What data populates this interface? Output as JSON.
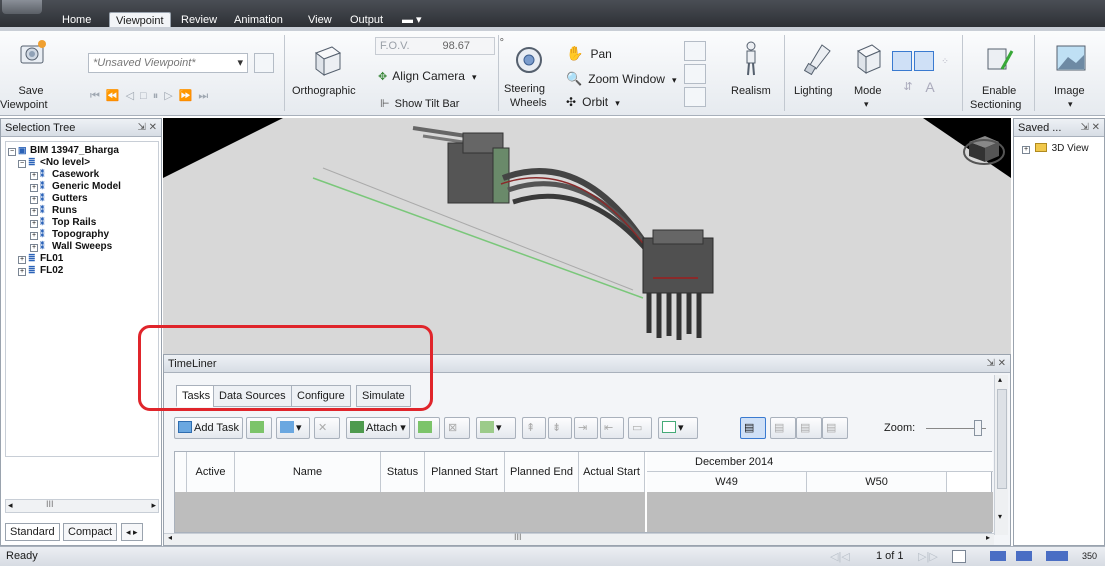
{
  "menu": {
    "tabs": [
      "Home",
      "Viewpoint",
      "Review",
      "Animation",
      "View",
      "Output"
    ],
    "active": "Viewpoint"
  },
  "ribbon": {
    "save_viewpoint": "Save\nViewpoint",
    "save_line1": "Save",
    "save_line2": "Viewpoint",
    "viewpoint_combo": "*Unsaved Viewpoint*",
    "orthographic": "Orthographic",
    "fov_label": "F.O.V.",
    "fov_value": "98.67",
    "fov_unit": "°",
    "align_camera": "Align Camera",
    "show_tilt_bar": "Show Tilt Bar",
    "steering_line1": "Steering",
    "steering_line2": "Wheels",
    "pan": "Pan",
    "zoom_window": "Zoom Window",
    "orbit": "Orbit",
    "realism": "Realism",
    "lighting": "Lighting",
    "mode": "Mode",
    "enable_line1": "Enable",
    "enable_line2": "Sectioning",
    "image": "Image"
  },
  "selection_tree": {
    "title": "Selection Tree",
    "items": [
      {
        "label": "BIM 13947_Bharga",
        "depth": 0
      },
      {
        "label": "<No level>",
        "depth": 1
      },
      {
        "label": "Casework",
        "depth": 2
      },
      {
        "label": "Generic Model",
        "depth": 2
      },
      {
        "label": "Gutters",
        "depth": 2
      },
      {
        "label": "Runs",
        "depth": 2
      },
      {
        "label": "Top Rails",
        "depth": 2
      },
      {
        "label": "Topography",
        "depth": 2
      },
      {
        "label": "Wall Sweeps",
        "depth": 2
      },
      {
        "label": "FL01",
        "depth": 1
      },
      {
        "label": "FL02",
        "depth": 1
      }
    ],
    "tab_standard": "Standard",
    "tab_compact": "Compact"
  },
  "timeliner": {
    "title": "TimeLiner",
    "tabs": [
      "Tasks",
      "Data Sources",
      "Configure",
      "Simulate"
    ],
    "active_tab": "Tasks",
    "add_task": "Add Task",
    "attach": "Attach",
    "zoom_label": "Zoom:",
    "columns": [
      "Active",
      "Name",
      "Status",
      "Planned Start",
      "Planned End",
      "Actual Start"
    ],
    "gantt_month": "December 2014",
    "gantt_weeks": [
      "W49",
      "W50"
    ]
  },
  "saved_viewpoints": {
    "title": "Saved ...",
    "items": [
      "3D View"
    ]
  },
  "status": {
    "text": "Ready",
    "page": "1 of 1",
    "number": "350"
  }
}
